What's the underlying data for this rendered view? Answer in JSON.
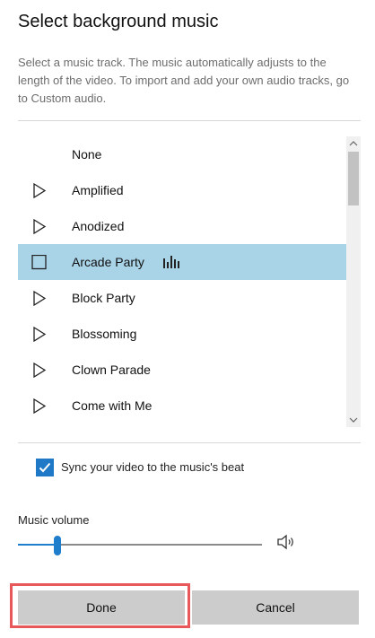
{
  "dialog": {
    "title": "Select background music",
    "description": "Select a music track. The music automatically adjusts to the length of the video. To import and add your own audio tracks, go to Custom audio."
  },
  "tracks": [
    {
      "label": "None",
      "icon": "none"
    },
    {
      "label": "Amplified",
      "icon": "play-icon"
    },
    {
      "label": "Anodized",
      "icon": "play-icon"
    },
    {
      "label": "Arcade Party",
      "icon": "stop-icon",
      "selected": true,
      "playing": true
    },
    {
      "label": "Block Party",
      "icon": "play-icon"
    },
    {
      "label": "Blossoming",
      "icon": "play-icon"
    },
    {
      "label": "Clown Parade",
      "icon": "play-icon"
    },
    {
      "label": "Come with Me",
      "icon": "play-icon"
    }
  ],
  "sync": {
    "label": "Sync your video to the music's beat",
    "checked": true
  },
  "volume": {
    "label": "Music volume",
    "value_fraction": 0.16,
    "icon": "speaker-icon"
  },
  "buttons": {
    "done": "Done",
    "cancel": "Cancel"
  },
  "colors": {
    "selected_row": "#a9d3e7",
    "accent": "#1e7ecb",
    "highlight": "#e8585a"
  }
}
